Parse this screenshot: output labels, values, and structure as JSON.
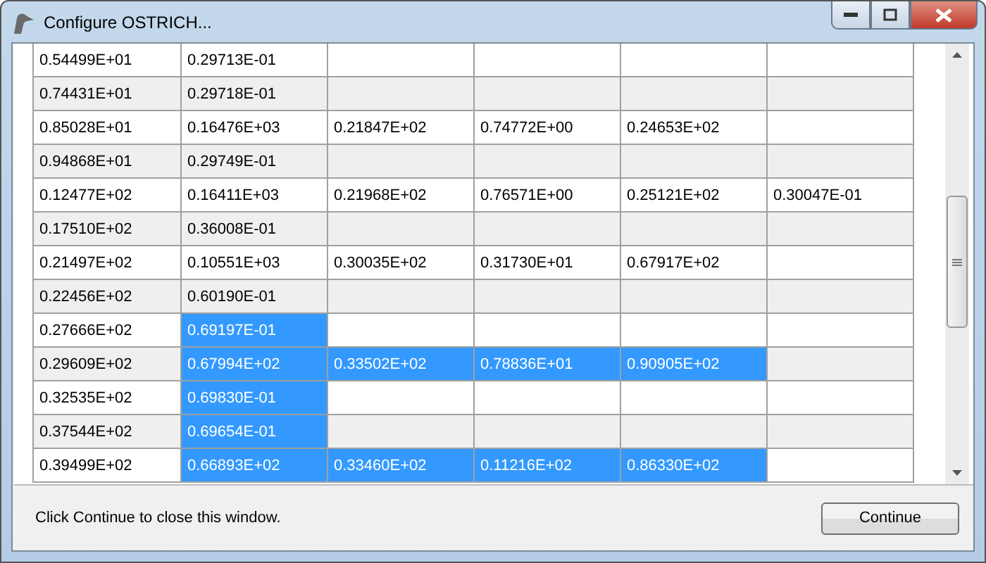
{
  "window": {
    "title": "Configure OSTRICH..."
  },
  "table": {
    "rows": [
      {
        "cells": [
          {
            "text": "0.54499E+01",
            "selected": false
          },
          {
            "text": "0.29713E-01",
            "selected": false
          }
        ]
      },
      {
        "cells": [
          {
            "text": "0.74431E+01",
            "selected": false
          },
          {
            "text": "0.29718E-01",
            "selected": false
          }
        ]
      },
      {
        "cells": [
          {
            "text": "0.85028E+01",
            "selected": false
          },
          {
            "text": "0.16476E+03",
            "selected": false
          },
          {
            "text": "0.21847E+02",
            "selected": false
          },
          {
            "text": "0.74772E+00",
            "selected": false
          },
          {
            "text": "0.24653E+02",
            "selected": false
          }
        ]
      },
      {
        "cells": [
          {
            "text": "0.94868E+01",
            "selected": false
          },
          {
            "text": "0.29749E-01",
            "selected": false
          }
        ]
      },
      {
        "cells": [
          {
            "text": "0.12477E+02",
            "selected": false
          },
          {
            "text": "0.16411E+03",
            "selected": false
          },
          {
            "text": "0.21968E+02",
            "selected": false
          },
          {
            "text": "0.76571E+00",
            "selected": false
          },
          {
            "text": "0.25121E+02",
            "selected": false
          },
          {
            "text": "0.30047E-01",
            "selected": false
          }
        ]
      },
      {
        "cells": [
          {
            "text": "0.17510E+02",
            "selected": false
          },
          {
            "text": "0.36008E-01",
            "selected": false
          }
        ]
      },
      {
        "cells": [
          {
            "text": "0.21497E+02",
            "selected": false
          },
          {
            "text": "0.10551E+03",
            "selected": false
          },
          {
            "text": "0.30035E+02",
            "selected": false
          },
          {
            "text": "0.31730E+01",
            "selected": false
          },
          {
            "text": "0.67917E+02",
            "selected": false
          }
        ]
      },
      {
        "cells": [
          {
            "text": "0.22456E+02",
            "selected": false
          },
          {
            "text": "0.60190E-01",
            "selected": false
          }
        ]
      },
      {
        "cells": [
          {
            "text": "0.27666E+02",
            "selected": false
          },
          {
            "text": "0.69197E-01",
            "selected": true
          }
        ]
      },
      {
        "cells": [
          {
            "text": "0.29609E+02",
            "selected": false
          },
          {
            "text": "0.67994E+02",
            "selected": true
          },
          {
            "text": "0.33502E+02",
            "selected": true
          },
          {
            "text": "0.78836E+01",
            "selected": true
          },
          {
            "text": "0.90905E+02",
            "selected": true
          }
        ]
      },
      {
        "cells": [
          {
            "text": "0.32535E+02",
            "selected": false
          },
          {
            "text": "0.69830E-01",
            "selected": true
          }
        ]
      },
      {
        "cells": [
          {
            "text": "0.37544E+02",
            "selected": false
          },
          {
            "text": "0.69654E-01",
            "selected": true
          }
        ]
      },
      {
        "cells": [
          {
            "text": "0.39499E+02",
            "selected": false
          },
          {
            "text": "0.66893E+02",
            "selected": true
          },
          {
            "text": "0.33460E+02",
            "selected": true
          },
          {
            "text": "0.11216E+02",
            "selected": true
          },
          {
            "text": "0.86330E+02",
            "selected": true
          }
        ]
      }
    ]
  },
  "status": {
    "message": "Click Continue to close this window."
  },
  "buttons": [
    {
      "label": "Continue"
    }
  ]
}
